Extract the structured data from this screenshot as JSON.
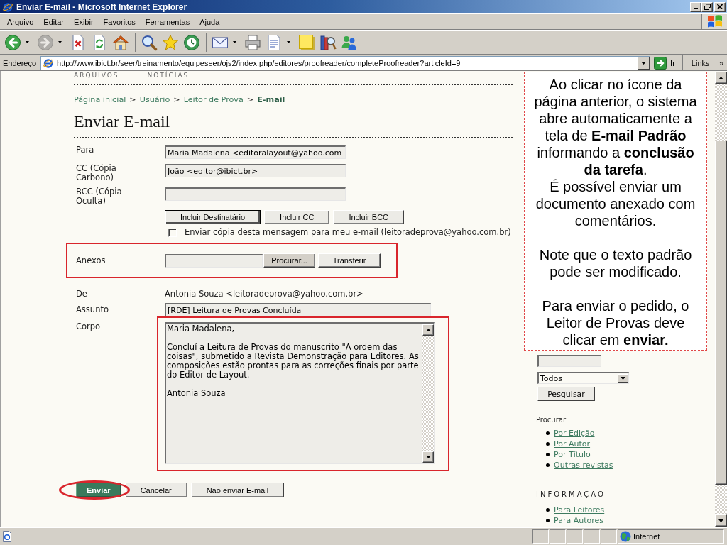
{
  "window": {
    "title": "Enviar E-mail - Microsoft Internet Explorer"
  },
  "menu": [
    "Arquivo",
    "Editar",
    "Exibir",
    "Favoritos",
    "Ferramentas",
    "Ajuda"
  ],
  "toolbar": [
    {
      "kind": "back",
      "dropdown": true,
      "disabled": false
    },
    {
      "kind": "forward",
      "dropdown": true,
      "disabled": true
    },
    {
      "kind": "stop",
      "dropdown": false,
      "disabled": false
    },
    {
      "kind": "refresh",
      "dropdown": false,
      "disabled": false
    },
    {
      "kind": "home",
      "dropdown": false,
      "disabled": false
    },
    {
      "kind": "separator"
    },
    {
      "kind": "search",
      "dropdown": false,
      "disabled": false
    },
    {
      "kind": "favorites",
      "dropdown": false,
      "disabled": false
    },
    {
      "kind": "history",
      "dropdown": false,
      "disabled": false
    },
    {
      "kind": "separator"
    },
    {
      "kind": "mail",
      "dropdown": true,
      "disabled": false
    },
    {
      "kind": "print",
      "dropdown": false,
      "disabled": false
    },
    {
      "kind": "edit",
      "dropdown": true,
      "disabled": false
    },
    {
      "kind": "notes",
      "dropdown": false,
      "disabled": false
    },
    {
      "kind": "research",
      "dropdown": false,
      "disabled": false
    },
    {
      "kind": "messenger",
      "dropdown": false,
      "disabled": false
    }
  ],
  "address_bar": {
    "label": "Endereço",
    "url": "http://www.ibict.br/seer/treinamento/equipeseer/ojs2/index.php/editores/proofreader/completeProofreader?articleId=9",
    "go": "Ir",
    "links": "Links",
    "more": "»"
  },
  "page": {
    "nav": [
      "ARQUIVOS",
      "NOTÍCIAS"
    ],
    "breadcrumb": [
      {
        "kind": "link",
        "text": "Página inicial"
      },
      {
        "kind": "separator",
        "text": ">"
      },
      {
        "kind": "link",
        "text": "Usuário"
      },
      {
        "kind": "separator",
        "text": ">"
      },
      {
        "kind": "link",
        "text": "Leitor de Prova"
      },
      {
        "kind": "separator",
        "text": ">"
      },
      {
        "kind": "current",
        "text": "E-mail"
      }
    ],
    "title": "Enviar E-mail",
    "form": {
      "recipients": [
        {
          "label": "Para",
          "value": "Maria Madalena <editoralayout@yahoo.com"
        },
        {
          "label": "CC (Cópia Carbono)",
          "value": "João <editor@ibict.br>"
        },
        {
          "label": "BCC (Cópia Oculta)"
        }
      ],
      "add_buttons": [
        {
          "label": "Incluir Destinatário",
          "default": true
        },
        {
          "label": "Incluir CC",
          "default": false
        },
        {
          "label": "Incluir BCC",
          "default": false
        }
      ],
      "copy_to_self": {
        "label": "Enviar cópia desta mensagem para meu e-mail (leitoradeprova@yahoo.com.br)",
        "checked": false
      },
      "attachments": {
        "label": "Anexos",
        "browse": "Procurar...",
        "upload": "Transferir",
        "highlighted": true
      },
      "from": {
        "label": "De",
        "value": "Antonia Souza <leitoradeprova@yahoo.com.br>"
      },
      "subject": {
        "label": "Assunto",
        "value": "[RDE] Leitura de Provas Concluída"
      },
      "body": {
        "label": "Corpo",
        "paragraphs": [
          "Maria Madalena,",
          "Concluí a Leitura de Provas do manuscrito \"A ordem das coisas\", submetido a Revista Demonstração para Editores. As composições estão prontas para as correções finais por parte do Editor de Layout.",
          "Antonia Souza"
        ],
        "highlighted": true
      },
      "actions": [
        {
          "label": "Enviar",
          "kind": "primary",
          "circled": true
        },
        {
          "label": "Cancelar",
          "kind": "secondary",
          "circled": false
        },
        {
          "label": "Não enviar E-mail",
          "kind": "secondary",
          "circled": false
        }
      ]
    },
    "callout": {
      "groups": [
        {
          "paragraphs": [
            "Ao clicar no ícone da página anterior, o sistema abre automaticamente a tela de **E-mail Padrão** informando a **conclusão da tarefa**.",
            "É possível enviar um documento anexado com comentários."
          ]
        },
        {
          "paragraphs": [
            "Note que o texto padrão pode ser modificado."
          ]
        },
        {
          "paragraphs": [
            "Para enviar o pedido, o Leitor de Provas deve clicar em **enviar.**"
          ]
        }
      ]
    },
    "sidebar": {
      "search": {
        "scope": "Todos",
        "button": "Pesquisar"
      },
      "blocks": [
        {
          "kind": "label",
          "heading": "Procurar",
          "links": [
            "Por Edição",
            "Por Autor",
            "Por Título",
            "Outras revistas"
          ]
        },
        {
          "kind": "title",
          "heading": "INFORMAÇÃO",
          "links": [
            "Para Leitores",
            "Para Autores"
          ]
        }
      ]
    }
  },
  "status_bar": {
    "zone": "Internet"
  }
}
